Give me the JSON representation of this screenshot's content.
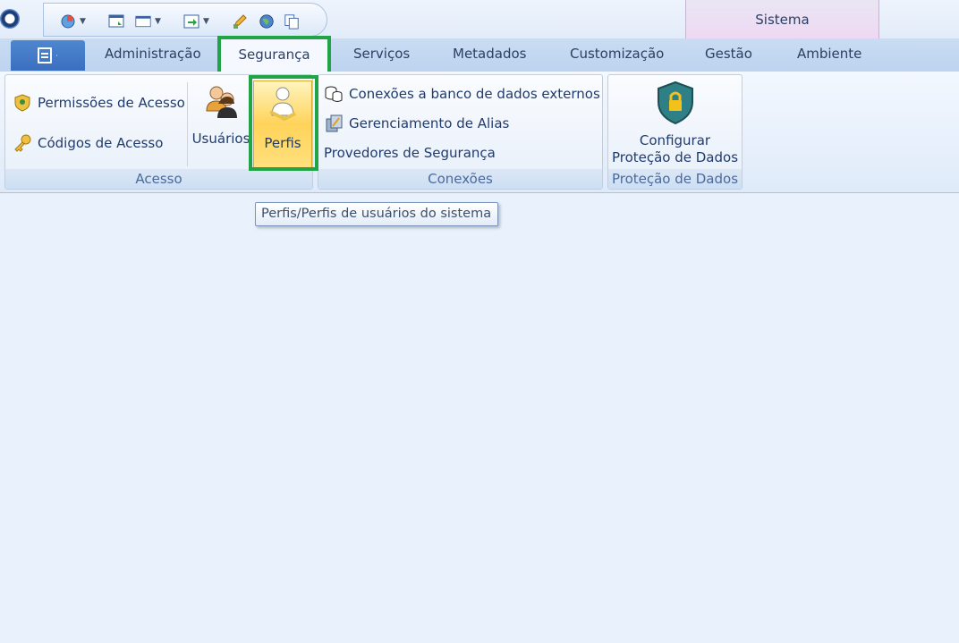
{
  "titlebar": {
    "context_tab": "Sistema"
  },
  "tabs": {
    "administracao": "Administração",
    "seguranca": "Segurança",
    "servicos": "Serviços",
    "metadados": "Metadados",
    "customizacao": "Customização",
    "gestao": "Gestão",
    "ambiente": "Ambiente"
  },
  "ribbon": {
    "acesso": {
      "label": "Acesso",
      "permissoes": "Permissões de Acesso",
      "codigos": "Códigos de Acesso",
      "usuarios": "Usuários",
      "perfis": "Perfis"
    },
    "conexoes": {
      "label": "Conexões",
      "banco": "Conexões a banco de dados externos",
      "alias": "Gerenciamento de Alias",
      "provedores": "Provedores de Segurança"
    },
    "protecao": {
      "label": "Proteção de Dados",
      "configurar_line1": "Configurar",
      "configurar_line2": "Proteção de Dados"
    }
  },
  "tooltip": "Perfis/Perfis de usuários do sistema",
  "icons": {
    "app_orb": "app-orb-icon",
    "qat": [
      "web-globe-icon",
      "save-window-icon",
      "window-icon",
      "export-icon",
      "pencil-icon",
      "world-icon",
      "copy-icon"
    ],
    "permissoes": "shield-key-icon",
    "codigos": "key-icon",
    "usuarios": "users-icon",
    "perfis": "profile-key-icon",
    "banco": "database-icon",
    "alias": "alias-icon",
    "protecao": "shield-lock-icon"
  },
  "colors": {
    "highlight": "#21a445",
    "active_button": "#ffd35a",
    "context_tab": "#efd8f3"
  }
}
